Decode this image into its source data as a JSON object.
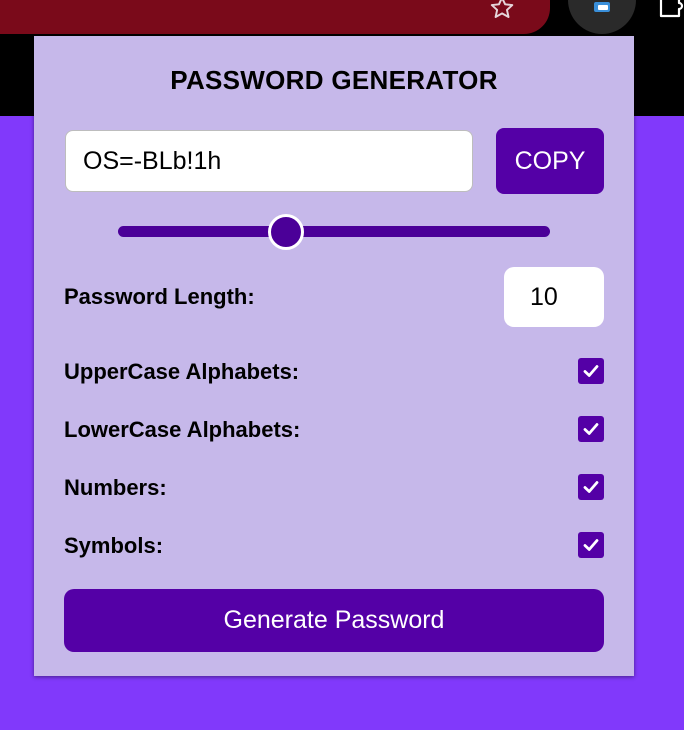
{
  "browser": {
    "colors": {
      "tab": "#7a0a1a",
      "bar": "#000000",
      "page_bg": "#8139fb"
    },
    "icons": [
      "bookmark-star-icon",
      "extension-icon",
      "puzzle-icon"
    ]
  },
  "popup": {
    "title": "PASSWORD GENERATOR",
    "password": "OS=-BLb!1h",
    "copy_label": "COPY",
    "slider_value_fraction": 0.39,
    "length_label": "Password Length:",
    "length_value": "10",
    "options": [
      {
        "label": "UpperCase Alphabets:",
        "checked": true
      },
      {
        "label": "LowerCase Alphabets:",
        "checked": true
      },
      {
        "label": "Numbers:",
        "checked": true
      },
      {
        "label": "Symbols:",
        "checked": true
      }
    ],
    "generate_label": "Generate Password",
    "colors": {
      "panel_bg": "#c6b8ea",
      "accent": "#5400a6",
      "slider": "#4b0098"
    }
  }
}
